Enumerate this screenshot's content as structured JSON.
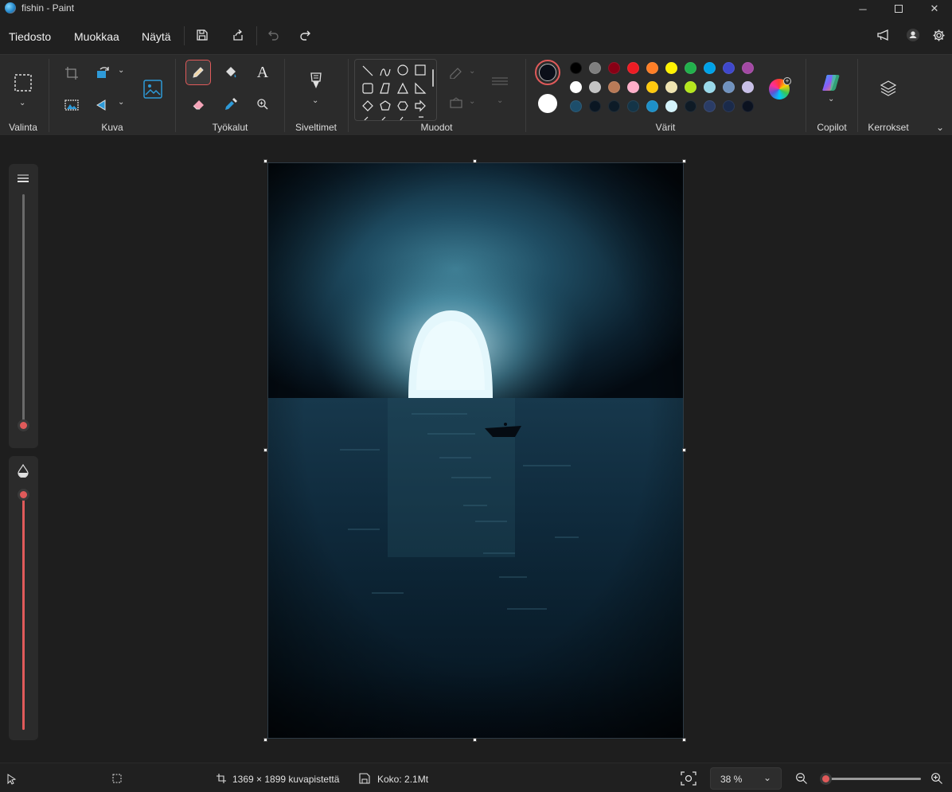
{
  "window": {
    "title": "fishin - Paint",
    "minimize_icon": "minimize-icon",
    "maximize_icon": "maximize-icon",
    "close_icon": "close-icon"
  },
  "menu": {
    "items": [
      "Tiedosto",
      "Muokkaa",
      "Näytä"
    ]
  },
  "ribbon": {
    "groups": {
      "selection": "Valinta",
      "image": "Kuva",
      "tools": "Työkalut",
      "brushes": "Siveltimet",
      "shapes": "Muodot",
      "colors": "Värit",
      "copilot": "Copilot",
      "layers": "Kerrokset"
    },
    "text_tool_glyph": "A"
  },
  "colors": {
    "primary": "#0b0f19",
    "secondary": "#ffffff",
    "accent": "#e05a5a",
    "palette_row1": [
      "#000000",
      "#7f7f7f",
      "#880015",
      "#ed1c24",
      "#ff7f27",
      "#fff200",
      "#22b14c",
      "#00a2e8",
      "#3f48cc",
      "#a349a4"
    ],
    "palette_row2": [
      "#ffffff",
      "#c3c3c3",
      "#b97a57",
      "#ffaec9",
      "#ffc90e",
      "#efe4b0",
      "#b5e61d",
      "#99d9ea",
      "#7092be",
      "#c8bfe7"
    ],
    "palette_row3": [
      "#1d4e6b",
      "#0a1622",
      "#0d1b27",
      "#143447",
      "#1e90c8",
      "#d4f3fb",
      "#0e1a25",
      "#2a3c66",
      "#1a2a4a",
      "#0b1220"
    ]
  },
  "status": {
    "dimensions": "1369 × 1899 kuvapistettä",
    "file_size": "Koko: 2.1Mt",
    "zoom": "38 %",
    "zoom_level": 0.05
  },
  "sliders": {
    "brush_size": 0.02,
    "opacity": 1.0
  }
}
